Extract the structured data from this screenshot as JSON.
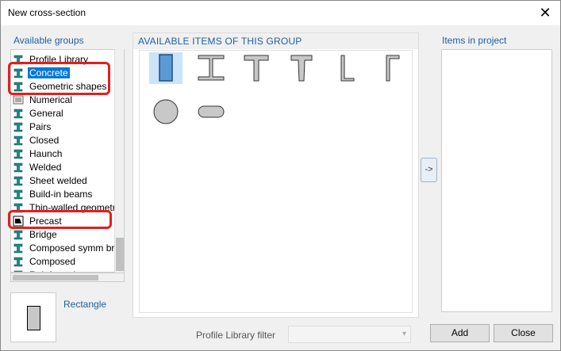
{
  "window": {
    "title": "New cross-section",
    "close_glyph": "✕"
  },
  "labels": {
    "available_groups": "Available groups",
    "available_items": "AVAILABLE ITEMS OF THIS GROUP",
    "items_in_project": "Items in project",
    "preview_name": "Rectangle",
    "filter_label": "Profile Library filter"
  },
  "groups": [
    {
      "label": "Profile Library",
      "icon": "profile-library-icon",
      "selected": false
    },
    {
      "label": "Concrete",
      "icon": "concrete-icon",
      "selected": true
    },
    {
      "label": "Geometric shapes",
      "icon": "geometric-shapes-icon",
      "selected": false
    },
    {
      "label": "Numerical",
      "icon": "numerical-icon",
      "selected": false
    },
    {
      "label": "General",
      "icon": "general-icon",
      "selected": false
    },
    {
      "label": "Pairs",
      "icon": "pairs-icon",
      "selected": false
    },
    {
      "label": "Closed",
      "icon": "closed-icon",
      "selected": false
    },
    {
      "label": "Haunch",
      "icon": "haunch-icon",
      "selected": false
    },
    {
      "label": "Welded",
      "icon": "welded-icon",
      "selected": false
    },
    {
      "label": "Sheet welded",
      "icon": "sheet-welded-icon",
      "selected": false
    },
    {
      "label": "Build-in beams",
      "icon": "build-in-beams-icon",
      "selected": false
    },
    {
      "label": "Thin-walled geometr",
      "icon": "thin-walled-icon",
      "selected": false
    },
    {
      "label": "Precast",
      "icon": "precast-icon",
      "selected": false
    },
    {
      "label": "Bridge",
      "icon": "bridge-icon",
      "selected": false
    },
    {
      "label": "Composed symm bric",
      "icon": "composed-symm-icon",
      "selected": false
    },
    {
      "label": "Composed",
      "icon": "composed-icon",
      "selected": false
    },
    {
      "label": "Reinforced",
      "icon": "reinforced-icon",
      "selected": false
    }
  ],
  "shapes": [
    {
      "name": "rectangle-shape-icon",
      "selected": true
    },
    {
      "name": "i-section-shape-icon",
      "selected": false
    },
    {
      "name": "t-section-shape-icon",
      "selected": false
    },
    {
      "name": "t-tapered-shape-icon",
      "selected": false
    },
    {
      "name": "l-section-shape-icon",
      "selected": false
    },
    {
      "name": "inverted-l-shape-icon",
      "selected": false
    },
    {
      "name": "circle-shape-icon",
      "selected": false
    },
    {
      "name": "oval-shape-icon",
      "selected": false
    }
  ],
  "buttons": {
    "move": "->",
    "add": "Add",
    "close": "Close"
  },
  "colors": {
    "accent": "#0078d7",
    "highlight": "#e41e1e",
    "label": "#1f5fa0",
    "icon_teal": "#1a8a8a"
  }
}
